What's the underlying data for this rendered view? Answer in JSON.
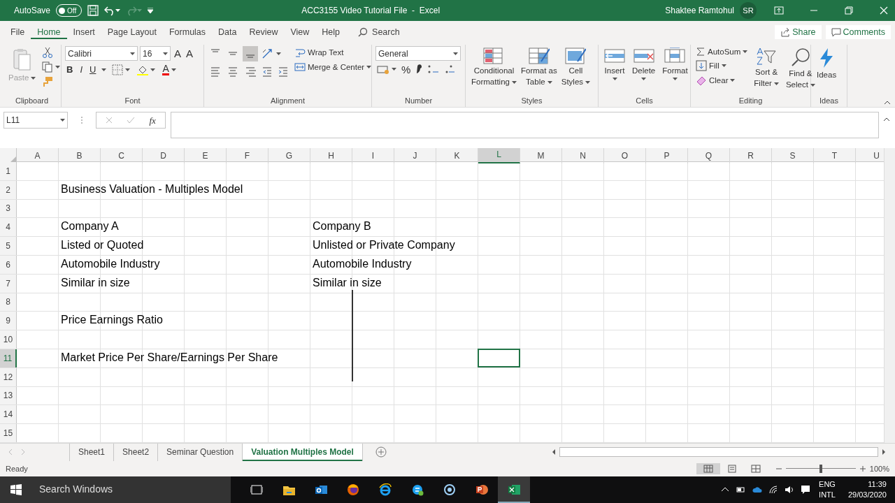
{
  "title_bar": {
    "autosave_label": "AutoSave",
    "autosave": {
      "on": false,
      "text": "Off"
    },
    "title": "ACC3155 Video Tutorial File  -  Excel",
    "user_name": "Shaktee Ramtohul",
    "user_initials": "SR"
  },
  "ribbon_tabs": [
    {
      "label": "File",
      "selected": false
    },
    {
      "label": "Home",
      "selected": true
    },
    {
      "label": "Insert",
      "selected": false
    },
    {
      "label": "Page Layout",
      "selected": false
    },
    {
      "label": "Formulas",
      "selected": false
    },
    {
      "label": "Data",
      "selected": false
    },
    {
      "label": "Review",
      "selected": false
    },
    {
      "label": "View",
      "selected": false
    },
    {
      "label": "Help",
      "selected": false
    }
  ],
  "search": "Search",
  "share": "Share",
  "comments": "Comments",
  "clipboard": {
    "paste": "Paste",
    "paste_disabled": true,
    "group": "Clipboard"
  },
  "font": {
    "name": "Calibri",
    "size": "16",
    "grow": "A",
    "shrink": "A",
    "bold": "B",
    "italic": "I",
    "underline": "U",
    "font_color": "A",
    "group": "Font"
  },
  "alignment": {
    "vertical": [
      {
        "selected": false
      },
      {
        "selected": false
      },
      {
        "selected": true
      }
    ],
    "wrap": "Wrap Text",
    "merge": "Merge & Center",
    "group": "Alignment"
  },
  "number": {
    "format": "General",
    "percent": "%",
    "group": "Number"
  },
  "styles": {
    "buttons": [
      [
        "Conditional",
        "Formatting"
      ],
      [
        "Format as",
        "Table"
      ],
      [
        "Cell",
        "Styles"
      ]
    ],
    "group": "Styles"
  },
  "cells": {
    "buttons": [
      "Insert",
      "Delete",
      "Format"
    ],
    "group": "Cells"
  },
  "editing": {
    "autosum": "AutoSum",
    "fill": "Fill",
    "clear": "Clear",
    "sort": [
      "Sort &",
      "Filter"
    ],
    "find": [
      "Find &",
      "Select"
    ],
    "group": "Editing"
  },
  "ideas": {
    "label": "Ideas",
    "group": "Ideas"
  },
  "name_box": "L11",
  "function_label": "fx",
  "columns": [
    {
      "label": "A",
      "selected": false
    },
    {
      "label": "B",
      "selected": false
    },
    {
      "label": "C",
      "selected": false
    },
    {
      "label": "D",
      "selected": false
    },
    {
      "label": "E",
      "selected": false
    },
    {
      "label": "F",
      "selected": false
    },
    {
      "label": "G",
      "selected": false
    },
    {
      "label": "H",
      "selected": false
    },
    {
      "label": "I",
      "selected": false
    },
    {
      "label": "J",
      "selected": false
    },
    {
      "label": "K",
      "selected": false
    },
    {
      "label": "L",
      "selected": true
    },
    {
      "label": "M",
      "selected": false
    },
    {
      "label": "N",
      "selected": false
    },
    {
      "label": "O",
      "selected": false
    },
    {
      "label": "P",
      "selected": false
    },
    {
      "label": "Q",
      "selected": false
    },
    {
      "label": "R",
      "selected": false
    },
    {
      "label": "S",
      "selected": false
    },
    {
      "label": "T",
      "selected": false
    },
    {
      "label": "U",
      "selected": false
    }
  ],
  "rows": [
    {
      "number": "1",
      "selected": false
    },
    {
      "number": "2",
      "selected": false,
      "cells": {
        "B": "Business Valuation - Multiples Model"
      }
    },
    {
      "number": "3",
      "selected": false
    },
    {
      "number": "4",
      "selected": false,
      "cells": {
        "B": "Company A",
        "H": "Company B"
      }
    },
    {
      "number": "5",
      "selected": false,
      "cells": {
        "B": "Listed or Quoted",
        "H": "Unlisted or Private Company"
      }
    },
    {
      "number": "6",
      "selected": false,
      "cells": {
        "B": "Automobile Industry",
        "H": "Automobile Industry"
      }
    },
    {
      "number": "7",
      "selected": false,
      "cells": {
        "B": "Similar in size",
        "H": "Similar in size"
      }
    },
    {
      "number": "8",
      "selected": false
    },
    {
      "number": "9",
      "selected": false,
      "cells": {
        "B": "Price Earnings Ratio"
      }
    },
    {
      "number": "10",
      "selected": false
    },
    {
      "number": "11",
      "selected": true,
      "cells": {
        "B": "Market Price Per Share/Earnings Per Share"
      }
    },
    {
      "number": "12",
      "selected": false
    },
    {
      "number": "13",
      "selected": false
    },
    {
      "number": "14",
      "selected": false
    },
    {
      "number": "15",
      "selected": false
    }
  ],
  "sheet_tabs": [
    {
      "label": "Sheet1",
      "selected": false
    },
    {
      "label": "Sheet2",
      "selected": false
    },
    {
      "label": "Seminar Question",
      "selected": false
    },
    {
      "label": "Valuation Multiples Model",
      "selected": true
    }
  ],
  "status": "Ready",
  "zoom_slider": {
    "level": 0.5
  },
  "zoom": "100%",
  "taskbar": {
    "search": "Search Windows",
    "language": [
      "ENG",
      "INTL"
    ],
    "time": "11:39",
    "date": "29/03/2020"
  }
}
